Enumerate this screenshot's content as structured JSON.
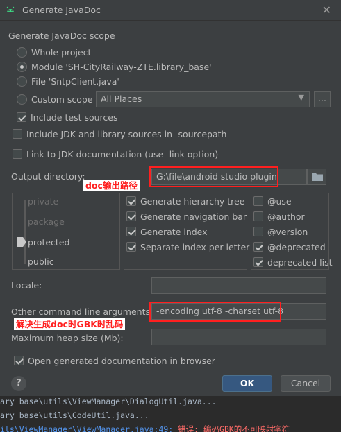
{
  "window": {
    "title": "Generate JavaDoc"
  },
  "scope": {
    "heading": "Generate JavaDoc scope",
    "whole_project": "Whole project",
    "module": "Module 'SH-CityRailway-ZTE.library_base'",
    "file": "File 'SntpClient.java'",
    "custom_scope": "Custom scope",
    "custom_scope_value": "All Places",
    "dots": "...",
    "include_test_sources": "Include test sources",
    "include_jdk": "Include JDK and library sources in -sourcepath",
    "link_jdk": "Link to JDK documentation (use -link option)"
  },
  "output": {
    "label": "Output directory:",
    "value": "G:\\file\\android studio plugin",
    "annotation": "doc输出路径"
  },
  "visibility": [
    "private",
    "package",
    "protected",
    "public"
  ],
  "options": [
    "Generate hierarchy tree",
    "Generate navigation bar",
    "Generate index",
    "Separate index per letter"
  ],
  "tags": [
    "@use",
    "@author",
    "@version",
    "@deprecated",
    "deprecated list"
  ],
  "locale": {
    "label": "Locale:",
    "value": ""
  },
  "other_args": {
    "label": "Other command line arguments:",
    "value": "-encoding utf-8 -charset utf-8",
    "annotation": "解决生成doc时GBK时乱码"
  },
  "heap": {
    "label": "Maximum heap size (Mb):",
    "value": ""
  },
  "open_browser": "Open generated documentation in browser",
  "buttons": {
    "help": "?",
    "ok": "OK",
    "cancel": "Cancel"
  },
  "console": {
    "line1": "ary_base\\utils\\ViewManager\\DialogUtil.java...",
    "line2": "ary_base\\utils\\CodeUtil.java...",
    "line3_link": "ils\\ViewManager\\ViewManager.java:49:",
    "line3_error": " 错误: 编码GBK的不可映射字符"
  },
  "state": {
    "scope_selected": "module",
    "include_test_sources": true,
    "include_jdk": false,
    "link_jdk": false,
    "visibility_selected": "protected",
    "options_checked": [
      true,
      true,
      true,
      true
    ],
    "tags_checked": [
      false,
      false,
      false,
      true,
      true
    ],
    "open_browser": true
  }
}
